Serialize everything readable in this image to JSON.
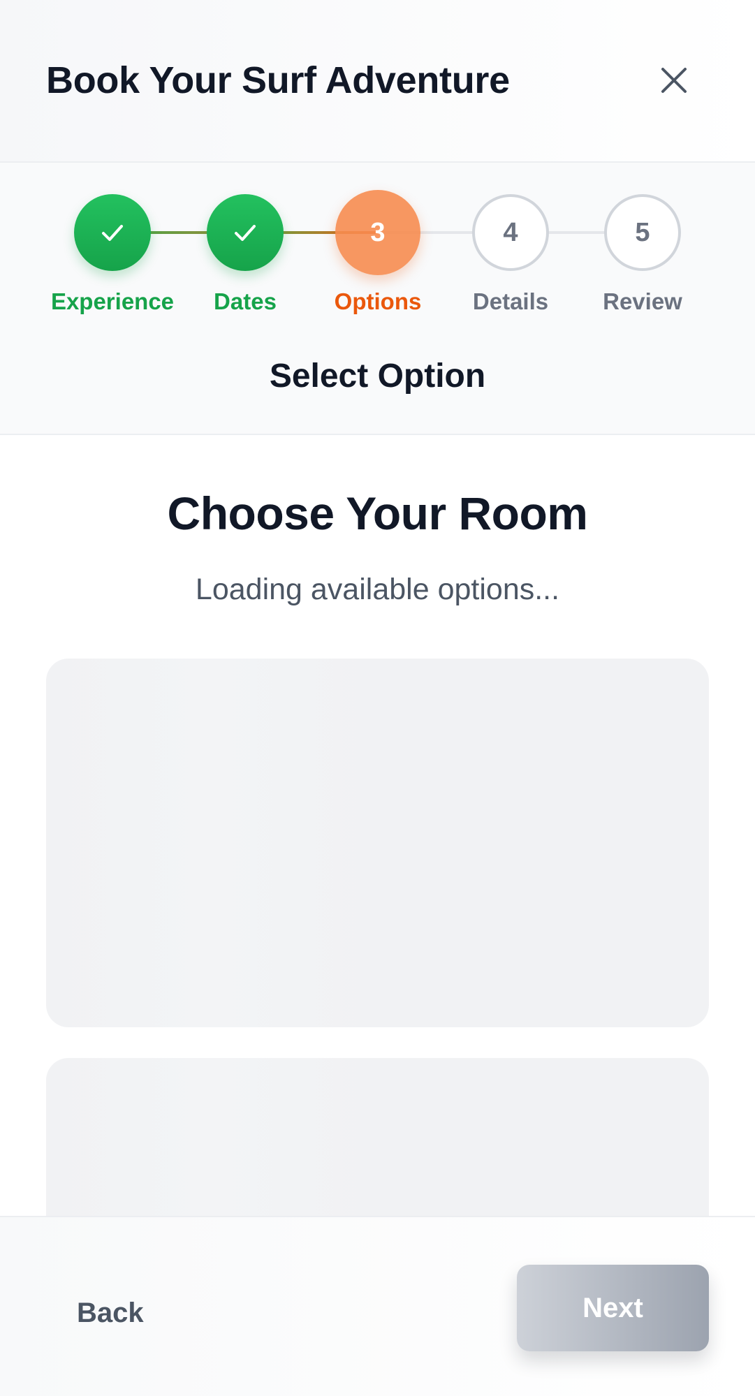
{
  "header": {
    "title": "Book Your Surf Adventure",
    "close_icon": "close-icon"
  },
  "stepper": {
    "steps": [
      {
        "number": "1",
        "label": "Experience",
        "status": "completed",
        "icon": "check-icon"
      },
      {
        "number": "2",
        "label": "Dates",
        "status": "completed",
        "icon": "check-icon"
      },
      {
        "number": "3",
        "label": "Options",
        "status": "current"
      },
      {
        "number": "4",
        "label": "Details",
        "status": "pending"
      },
      {
        "number": "5",
        "label": "Review",
        "status": "pending"
      }
    ],
    "heading": "Select Option"
  },
  "main": {
    "title": "Choose Your Room",
    "subtitle": "Loading available options..."
  },
  "footer": {
    "back_label": "Back",
    "next_label": "Next",
    "next_disabled": true
  },
  "colors": {
    "completed": "#16a34a",
    "current": "#ea580c",
    "pending": "#6b7280",
    "text": "#111827"
  }
}
